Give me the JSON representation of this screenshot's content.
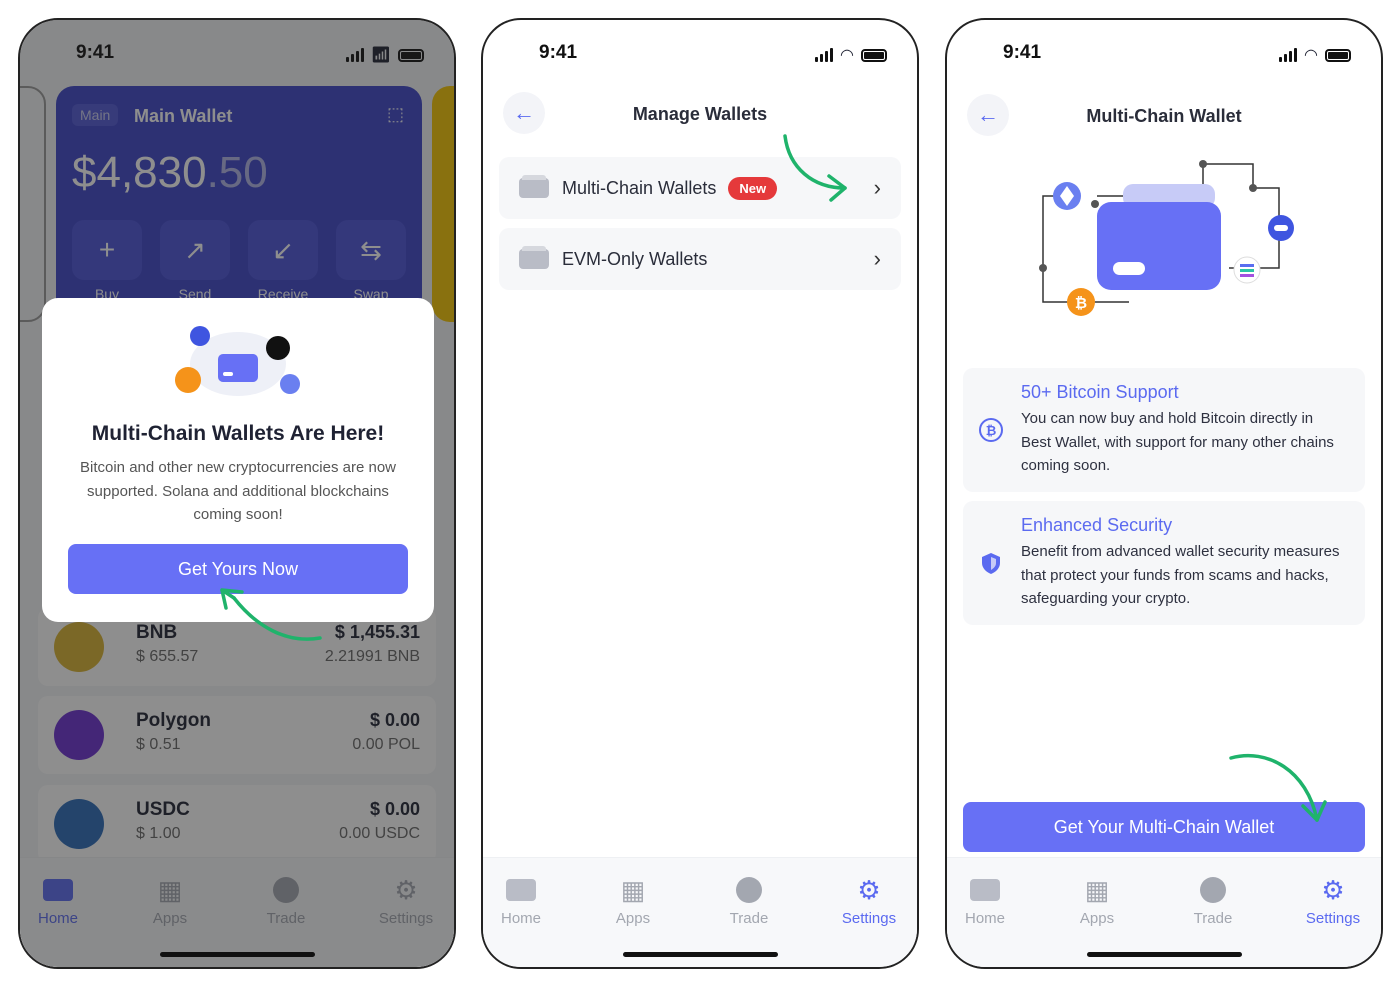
{
  "status": {
    "time": "9:41"
  },
  "tabs": [
    {
      "label": "Home"
    },
    {
      "label": "Apps"
    },
    {
      "label": "Trade"
    },
    {
      "label": "Settings"
    }
  ],
  "screen1": {
    "wallet": {
      "tag": "Main",
      "name": "Main Wallet",
      "balance_int": "$4,830",
      "balance_dec": ".50",
      "actions": [
        "Buy",
        "Send",
        "Receive",
        "Swap"
      ]
    },
    "assets": [
      {
        "name": "BNB",
        "price": "$ 655.57",
        "value": "$ 1,455.31",
        "amount": "2.21991 BNB",
        "color": "#d8b230"
      },
      {
        "name": "Polygon",
        "price": "$ 0.51",
        "value": "$ 0.00",
        "amount": "0.00 POL",
        "color": "#6a2fd0"
      },
      {
        "name": "USDC",
        "price": "$ 1.00",
        "value": "$ 0.00",
        "amount": "0.00 USDC",
        "color": "#2a6ab8"
      }
    ],
    "modal": {
      "title": "Multi-Chain Wallets Are Here!",
      "body": "Bitcoin and other new cryptocurrencies are now supported. Solana and additional blockchains coming soon!",
      "button": "Get Yours Now"
    },
    "active_tab": "Home"
  },
  "screen2": {
    "title": "Manage Wallets",
    "rows": [
      {
        "label": "Multi-Chain Wallets",
        "badge": "New"
      },
      {
        "label": "EVM-Only Wallets"
      }
    ],
    "active_tab": "Settings"
  },
  "screen3": {
    "title": "Multi-Chain Wallet",
    "features": [
      {
        "title": "50+ Bitcoin Support",
        "body": "You can now buy and hold Bitcoin directly in Best Wallet, with support for many other chains coming soon.",
        "icon": "bitcoin-icon"
      },
      {
        "title": "Enhanced Security",
        "body": "Benefit from advanced wallet security measures that protect your funds from scams and hacks, safeguarding your crypto.",
        "icon": "shield-icon"
      }
    ],
    "button": "Get Your Multi-Chain Wallet",
    "active_tab": "Settings"
  },
  "colors": {
    "accent": "#6770f5",
    "annotation_arrow": "#1fb36b",
    "badge": "#e5393b"
  }
}
